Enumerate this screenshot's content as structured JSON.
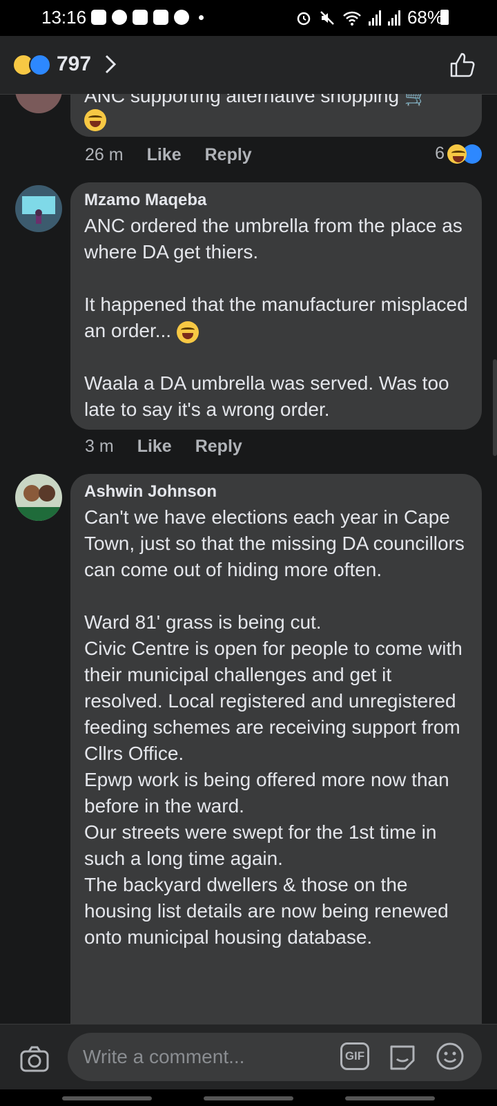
{
  "status_bar": {
    "time": "13:16",
    "battery": "68%"
  },
  "header": {
    "reaction_count": "797"
  },
  "comments": [
    {
      "text_partial": "ANC supporting alternative shopping",
      "time": "26 m",
      "like": "Like",
      "reply": "Reply",
      "reaction_count": "6"
    },
    {
      "author": "Mzamo Maqeba",
      "text": "ANC ordered the umbrella from the place as where DA get thiers.\n\nIt happened that the manufacturer misplaced an order...",
      "text2": "Waala a DA umbrella was served. Was too late to say it's a wrong order.",
      "time": "3 m",
      "like": "Like",
      "reply": "Reply"
    },
    {
      "author": "Ashwin Johnson",
      "text": "Can't we have elections each year in Cape Town, just so that the missing DA councillors can come out of hiding more often.\n\nWard 81' grass is being cut.\nCivic Centre is open for people to come with their municipal challenges and get it resolved. Local registered and unregistered feeding schemes are receiving support from Cllrs Office.\nEpwp work is being offered more now than before in the ward.\nOur streets were swept for the 1st time in such a long time again.\nThe backyard dwellers & those on the housing list details are now being renewed onto municipal housing database."
    }
  ],
  "composer": {
    "placeholder": "Write a comment...",
    "gif_label": "GIF"
  },
  "colors": {
    "background": "#18191a",
    "bubble": "#3a3b3c",
    "like_blue": "#2d88ff",
    "haha_yellow": "#f7c844"
  }
}
